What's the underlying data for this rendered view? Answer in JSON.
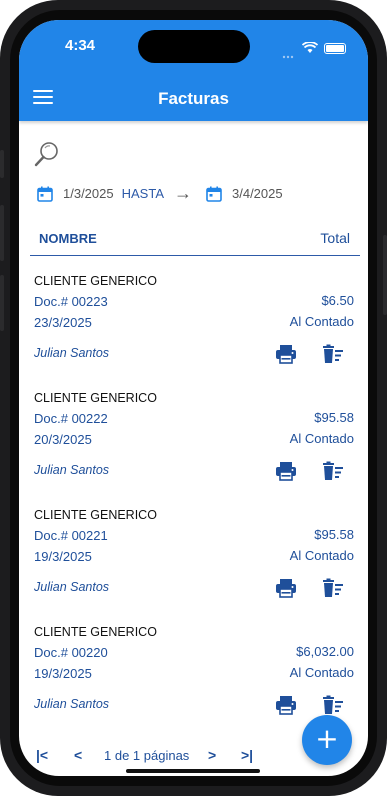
{
  "status": {
    "time": "4:34"
  },
  "appbar": {
    "title": "Facturas"
  },
  "filter": {
    "date_from": "1/3/2025",
    "hasta_label": "HASTA",
    "arrow": "→",
    "date_to": "3/4/2025"
  },
  "table": {
    "col_name": "NOMBRE",
    "col_total": "Total"
  },
  "invoices": [
    {
      "client": "CLIENTE GENERICO",
      "doc": "Doc.# 00223",
      "amount": "$6.50",
      "date": "23/3/2025",
      "payment": "Al Contado",
      "user": "Julian Santos"
    },
    {
      "client": "CLIENTE GENERICO",
      "doc": "Doc.# 00222",
      "amount": "$95.58",
      "date": "20/3/2025",
      "payment": "Al Contado",
      "user": "Julian Santos"
    },
    {
      "client": "CLIENTE GENERICO",
      "doc": "Doc.# 00221",
      "amount": "$95.58",
      "date": "19/3/2025",
      "payment": "Al Contado",
      "user": "Julian Santos"
    },
    {
      "client": "CLIENTE GENERICO",
      "doc": "Doc.# 00220",
      "amount": "$6,032.00",
      "date": "19/3/2025",
      "payment": "Al Contado",
      "user": "Julian Santos"
    }
  ],
  "pager": {
    "first": "|<",
    "prev": "<",
    "text": "1 de 1 páginas",
    "next": ">",
    "last": ">|"
  },
  "fab": {
    "label": "+"
  },
  "colors": {
    "primary": "#2185e8",
    "text_blue": "#1f4f9a"
  }
}
